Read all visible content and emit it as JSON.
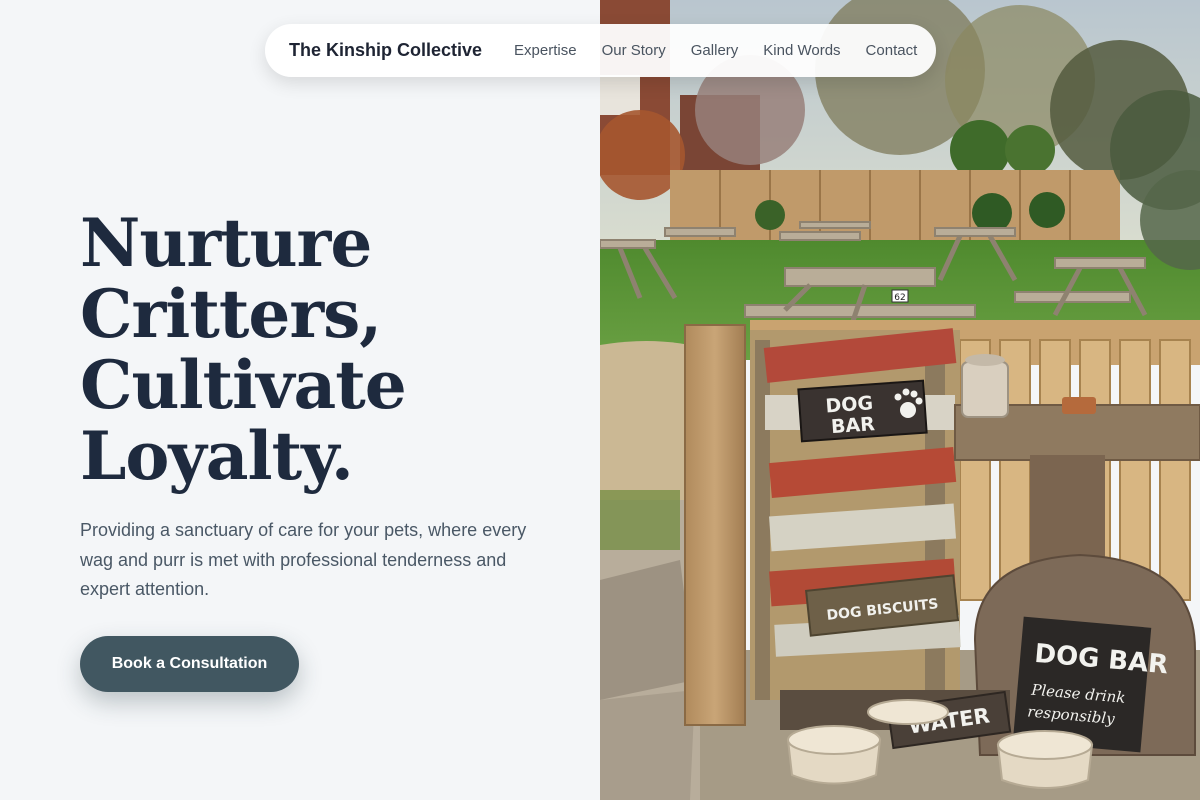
{
  "nav": {
    "brand": "The Kinship Collective",
    "links": [
      "Expertise",
      "Our Story",
      "Gallery",
      "Kind Words",
      "Contact"
    ]
  },
  "hero": {
    "title_lines": [
      "Nurture",
      "Critters,",
      "Cultivate",
      "Loyalty."
    ],
    "subtitle": "Providing a sanctuary of care for your pets, where every wag and purr is met with professional tenderness and expert attention.",
    "cta_label": "Book a Consultation"
  },
  "photo": {
    "sign_upper_line1": "DOG",
    "sign_upper_line2": "BAR",
    "biscuits_label": "DOG BISCUITS",
    "water_label": "WATER",
    "chalkboard_title": "DOG BAR",
    "chalkboard_line1": "Please drink",
    "chalkboard_line2": "responsibly",
    "table_number": "62"
  },
  "colors": {
    "page_bg": "#f4f6f8",
    "heading": "#1e2a3e",
    "body_text": "#4a5866",
    "button": "#415761"
  }
}
